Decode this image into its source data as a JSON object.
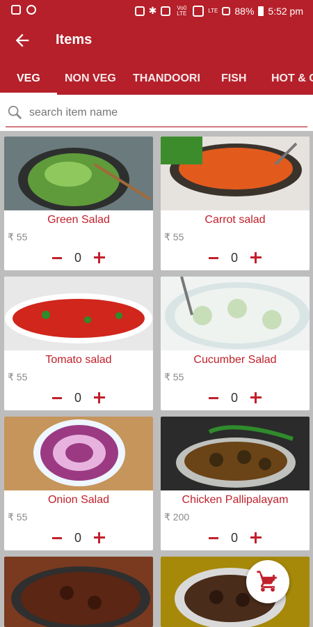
{
  "status": {
    "battery": "88%",
    "time": "5:52 pm",
    "net_top": "Vo0",
    "net_mid": "LTE",
    "net_bot": "LTE"
  },
  "appbar": {
    "title": "Items"
  },
  "tabs": [
    "VEG",
    "NON VEG",
    "THANDOORI",
    "FISH",
    "HOT & C"
  ],
  "search": {
    "placeholder": "search item name"
  },
  "items": [
    {
      "name": "Green Salad",
      "price": "₹ 55",
      "qty": "0"
    },
    {
      "name": "Carrot salad",
      "price": "₹ 55",
      "qty": "0"
    },
    {
      "name": "Tomato salad",
      "price": "₹ 55",
      "qty": "0"
    },
    {
      "name": "Cucumber Salad",
      "price": "₹ 55",
      "qty": "0"
    },
    {
      "name": "Onion Salad",
      "price": "₹ 55",
      "qty": "0"
    },
    {
      "name": "Chicken Pallipalayam",
      "price": "₹ 200",
      "qty": "0"
    }
  ],
  "colors": {
    "primary": "#b5202a",
    "accent": "#c0202a"
  },
  "icons": {
    "back": "arrow-left-icon",
    "search": "search-icon",
    "cart": "cart-add-icon"
  }
}
